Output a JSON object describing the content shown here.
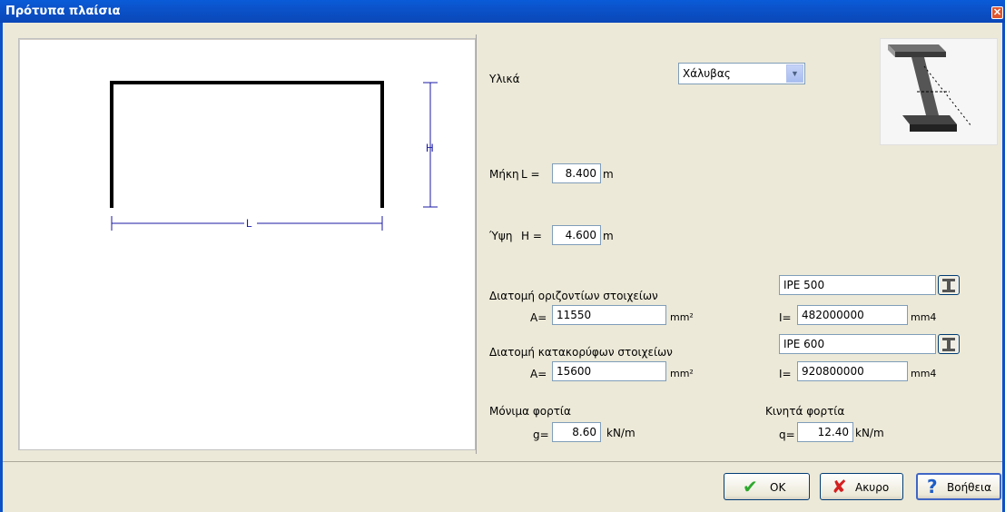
{
  "window": {
    "title": "Πρότυπα πλαίσια",
    "close_label": "✕"
  },
  "diagram": {
    "h_label": "H",
    "l_label": "L"
  },
  "material": {
    "label": "Υλικά",
    "value": "Χάλυβας"
  },
  "length": {
    "label": "Μήκη",
    "prefix": "L =",
    "value": "8.400",
    "unit": "m"
  },
  "height": {
    "label": "Ύψη",
    "prefix": "H =",
    "value": "4.600",
    "unit": "m"
  },
  "horizontal": {
    "label": "Διατομή οριζοντίων στοιχείων",
    "section": "IPE 500",
    "a_label": "A=",
    "a_value": "11550",
    "a_unit": "mm²",
    "i_label": "I=",
    "i_value": "482000000",
    "i_unit": "mm4"
  },
  "vertical": {
    "label": "Διατομή κατακορύφων στοιχείων",
    "section": "IPE 600",
    "a_label": "A=",
    "a_value": "15600",
    "a_unit": "mm²",
    "i_label": "I=",
    "i_value": "920800000",
    "i_unit": "mm4"
  },
  "dead_loads": {
    "label": "Μόνιμα φορτία",
    "prefix": "g=",
    "value": "8.60",
    "unit": "kN/m"
  },
  "live_loads": {
    "label": "Κινητά φορτία",
    "prefix": "q=",
    "value": "12.40",
    "unit": "kN/m"
  },
  "buttons": {
    "ok": "OK",
    "cancel": "Ακυρο",
    "help": "Βοήθεια"
  },
  "colors": {
    "titlebar": "#0b52c9",
    "frame": "#000000",
    "dimension": "#1a1aa6"
  }
}
